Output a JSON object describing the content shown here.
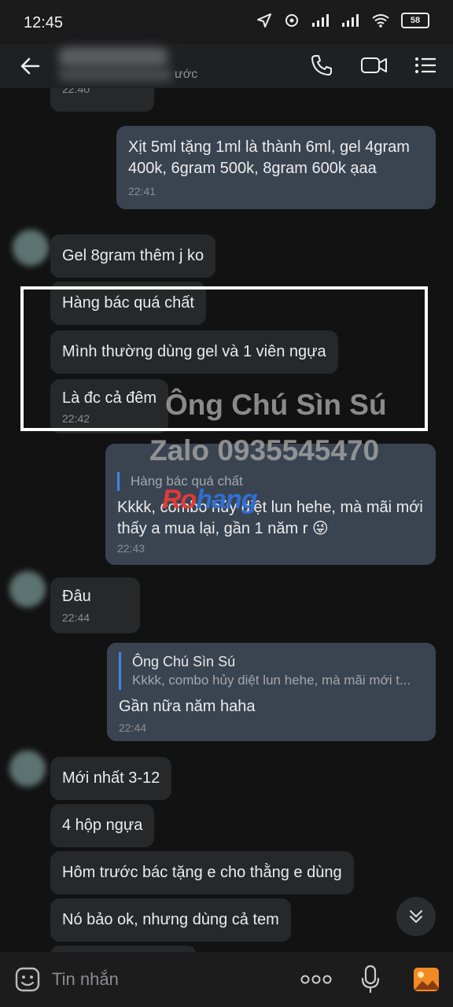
{
  "status_bar": {
    "time": "12:45",
    "battery": "58"
  },
  "header": {
    "contact_status_suffix": "ước"
  },
  "messages": [
    {
      "side": "me",
      "text": "Xịt 5ml tặng 1ml là thành 6ml, gel 4gram 400k, 6gram 500k, 8gram 600k ạaa",
      "time": "22:41"
    },
    {
      "side": "them",
      "text": "Gel 8gram thêm j ko"
    },
    {
      "side": "them",
      "text": "Hàng bác quá chất"
    },
    {
      "side": "them",
      "text": "Mình thường dùng gel và 1 viên ngựa"
    },
    {
      "side": "them",
      "text": "Là đc cả đêm",
      "time": "22:42"
    },
    {
      "side": "me",
      "quote_text": "Hàng bác quá chất",
      "text": "Kkkk, combo hủy diệt lun hehe, mà mãi mới thấy a mua lại, gần 1 năm r 😜",
      "time": "22:43"
    },
    {
      "side": "them",
      "text": "Đâu",
      "time": "22:44"
    },
    {
      "side": "me",
      "quote_name": "Ông Chú Sìn Sú",
      "quote_text": "Kkkk, combo hủy diệt lun hehe, mà mãi mới t...",
      "text": "Gần nữa năm haha",
      "time": "22:44"
    },
    {
      "side": "them",
      "text": "Mới nhất 3-12"
    },
    {
      "side": "them",
      "text": "4 hộp ngựa"
    },
    {
      "side": "them",
      "text": "Hôm trước bác tặng e cho thằng e dùng"
    },
    {
      "side": "them",
      "text": "Nó bảo ok, nhưng dùng cả tem"
    }
  ],
  "top_partial_time": "22:40",
  "watermark": {
    "line1": "Ông Chú Sìn Sú",
    "line2": "Zalo 0935545470",
    "logo_a": "Ro",
    "logo_b": "hang"
  },
  "input": {
    "placeholder": "Tin nhắn"
  },
  "colors": {
    "accent": "#3e86e7",
    "me_bubble": "#3a4451",
    "them_bubble": "#27282a",
    "highlight_box": "#ffffff"
  }
}
